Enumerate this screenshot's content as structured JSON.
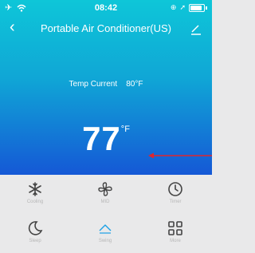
{
  "status_bar": {
    "time": "08:42"
  },
  "nav": {
    "title": "Portable Air Conditioner(US)"
  },
  "current": {
    "label": "Temp Current",
    "value": "80°F"
  },
  "setpoint": {
    "value": "77",
    "unit": "°F"
  },
  "modes": [
    {
      "label": "Cooling",
      "icon": "snowflake-icon"
    },
    {
      "label": "MID",
      "icon": "fan-icon"
    },
    {
      "label": "Timer",
      "icon": "clock-icon"
    },
    {
      "label": "Sleep",
      "icon": "moon-icon"
    },
    {
      "label": "Swing",
      "icon": "swing-icon"
    },
    {
      "label": "More",
      "icon": "grid-icon"
    }
  ],
  "colors": {
    "accent": "#1aa0e6",
    "pointer": "#e0262d",
    "icon": "#444444",
    "muted_label": "#b7b7b7"
  }
}
